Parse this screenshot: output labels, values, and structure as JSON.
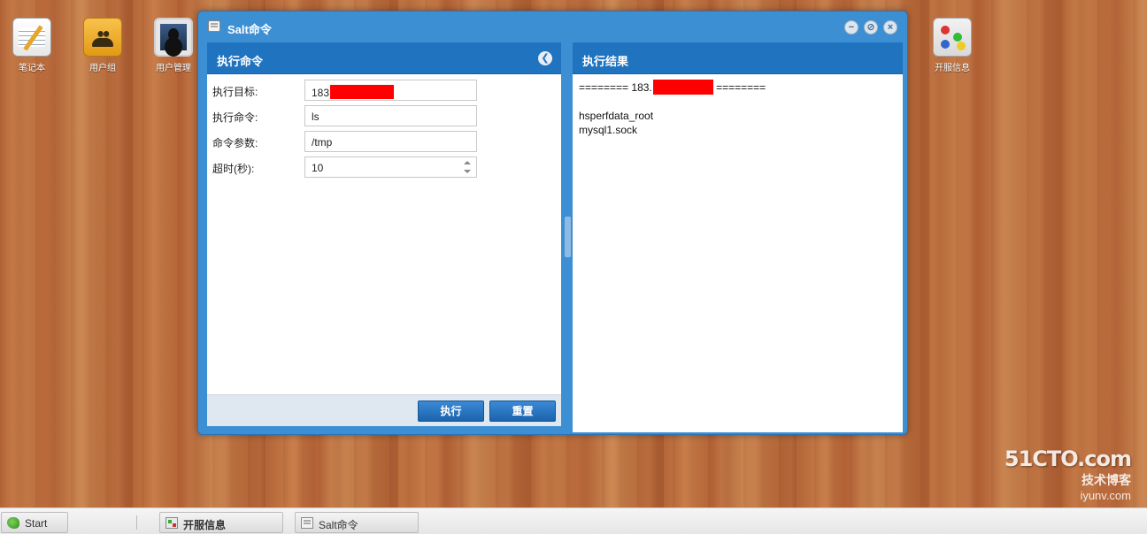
{
  "desktop": {
    "icons": [
      {
        "label": "笔记本",
        "icon": "notebook-icon"
      },
      {
        "label": "用户组",
        "icon": "user-group-icon"
      },
      {
        "label": "用户管理",
        "icon": "user-management-icon"
      },
      {
        "label": "开服信息",
        "icon": "game-controller-icon"
      }
    ]
  },
  "window": {
    "title": "Salt命令",
    "controls": [
      "minimize",
      "maximize",
      "close"
    ],
    "left_panel": {
      "title": "执行命令",
      "fields": [
        {
          "label": "执行目标:",
          "value": "183"
        },
        {
          "label": "执行命令:",
          "value": "ls"
        },
        {
          "label": "命令参数:",
          "value": "/tmp"
        },
        {
          "label": "超时(秒):",
          "value": "10"
        }
      ],
      "buttons": {
        "execute": "执行",
        "reset": "重置"
      }
    },
    "right_panel": {
      "title": "执行结果",
      "header_prefix": "======== 183.",
      "header_suffix": " ========",
      "lines": [
        "hsperfdata_root",
        "mysql1.sock"
      ]
    }
  },
  "taskbar": {
    "start": "Start",
    "tasks": [
      "开服信息",
      "Salt命令"
    ]
  },
  "watermark": {
    "line1": "51CTO.com",
    "line2": "技术博客",
    "line3": "iyunv.com"
  }
}
